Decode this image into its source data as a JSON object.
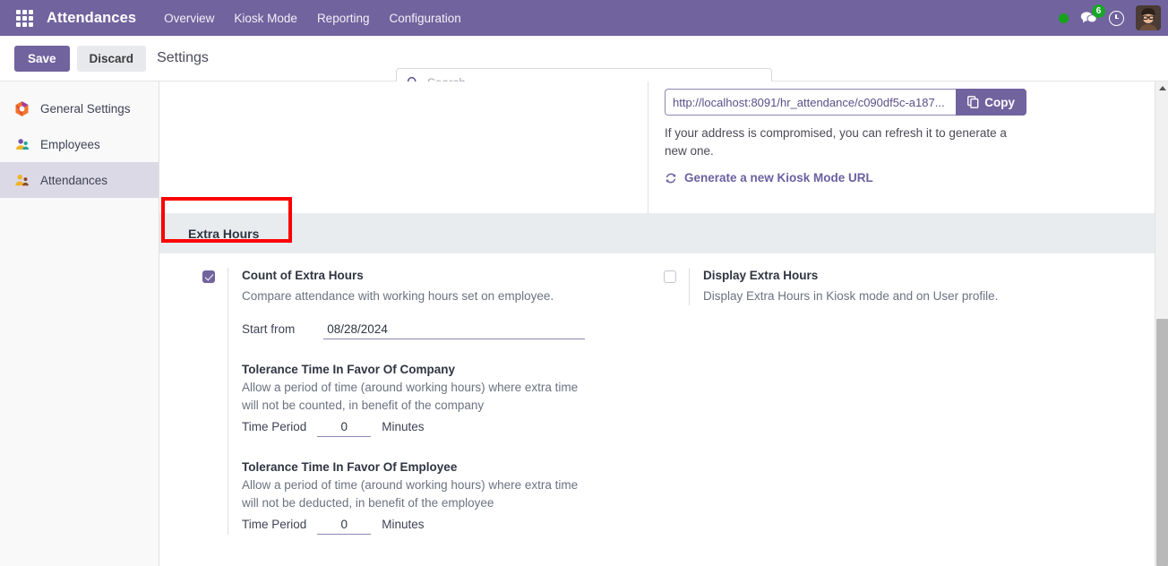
{
  "navbar": {
    "apps_icon": "apps-grid-icon",
    "brand": "Attendances",
    "items": [
      {
        "label": "Overview"
      },
      {
        "label": "Kiosk Mode"
      },
      {
        "label": "Reporting"
      },
      {
        "label": "Configuration"
      }
    ],
    "status_dot_color": "#15a31a",
    "messages_icon": "messages-icon",
    "messages_count": "6",
    "activity_icon": "clock-icon",
    "avatar": "user-avatar"
  },
  "controlbar": {
    "save_label": "Save",
    "discard_label": "Discard",
    "breadcrumb": "Settings",
    "accent_color": "#71639e"
  },
  "search": {
    "icon": "search-icon",
    "value": "",
    "placeholder": "Search..."
  },
  "sidebar": {
    "items": [
      {
        "label": "General Settings",
        "icon": "general-settings-icon",
        "active": false
      },
      {
        "label": "Employees",
        "icon": "employees-icon",
        "active": false
      },
      {
        "label": "Attendances",
        "icon": "attendances-icon",
        "active": true
      }
    ]
  },
  "kiosk": {
    "url": "http://localhost:8091/hr_attendance/c090df5c-a187...",
    "copy_label": "Copy",
    "copy_icon": "copy-icon",
    "help_text": "If your address is compromised, you can refresh it to generate a new one.",
    "generate_link": "Generate a new Kiosk Mode URL",
    "generate_icon": "refresh-icon"
  },
  "extra_hours_section": {
    "title": "Extra Hours",
    "highlight_color": "#fc0000",
    "band_color": "#e9ecef"
  },
  "count_extra_hours": {
    "checked": true,
    "label": "Count of Extra Hours",
    "description": "Compare attendance with working hours set on employee.",
    "start_from_label": "Start from",
    "start_from_value": "08/28/2024"
  },
  "display_extra_hours": {
    "checked": false,
    "label": "Display Extra Hours",
    "description": "Display Extra Hours in Kiosk mode and on User profile."
  },
  "tolerance_company": {
    "title": "Tolerance Time In Favor Of Company",
    "description": "Allow a period of time (around working hours) where extra time will not be counted, in benefit of the company",
    "period_label": "Time Period",
    "period_value": "0",
    "unit_label": "Minutes"
  },
  "tolerance_employee": {
    "title": "Tolerance Time In Favor Of Employee",
    "description": "Allow a period of time (around working hours) where extra time will not be deducted, in benefit of the employee",
    "period_label": "Time Period",
    "period_value": "0",
    "unit_label": "Minutes"
  }
}
